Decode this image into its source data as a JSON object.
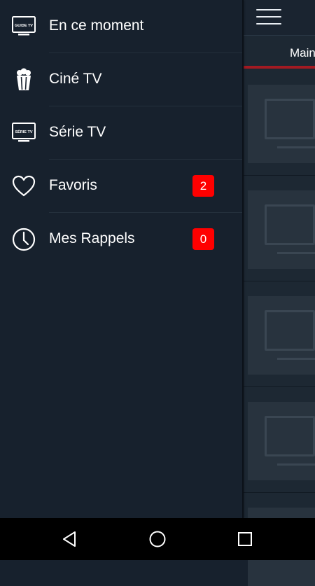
{
  "app": {
    "tab_label": "Main",
    "accent_color": "#a21a22"
  },
  "drawer": {
    "items": [
      {
        "label": "En ce moment",
        "icon": "guide-tv-icon",
        "icon_text": "GUIDE TV"
      },
      {
        "label": "Ciné TV",
        "icon": "popcorn-icon"
      },
      {
        "label": "Série TV",
        "icon": "serie-tv-icon",
        "icon_text": "SÉRIE TV"
      },
      {
        "label": "Favoris",
        "icon": "heart-icon",
        "badge": "2"
      },
      {
        "label": "Mes Rappels",
        "icon": "clock-icon",
        "badge": "0"
      }
    ],
    "badge_color": "#ff0000"
  },
  "navbar": {
    "buttons": [
      "back-icon",
      "home-icon",
      "recents-icon"
    ]
  }
}
